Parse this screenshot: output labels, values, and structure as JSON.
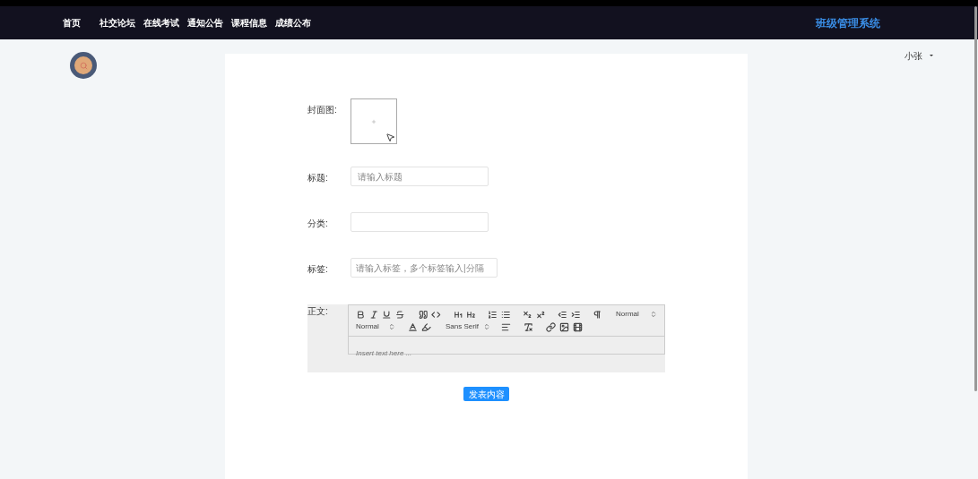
{
  "nav": {
    "items": [
      {
        "label": "首页",
        "selected": false
      },
      {
        "label": "社交论坛",
        "selected": false
      },
      {
        "label": "在线考试",
        "selected": false
      },
      {
        "label": "通知公告",
        "selected": false
      },
      {
        "label": "课程信息",
        "selected": false
      },
      {
        "label": "成绩公布",
        "selected": false
      }
    ],
    "brand": "班级管理系统"
  },
  "user": {
    "name": "小张"
  },
  "form": {
    "cover_label": "封面图:",
    "title_label": "标题:",
    "title_placeholder": "请输入标题",
    "category_label": "分类:",
    "tags_label": "标签:",
    "tags_placeholder": "请输入标签，多个标签输入|分隔",
    "body_label": "正文:",
    "editor": {
      "header_select": "Normal",
      "size_select": "Normal",
      "font_select": "Sans Serif",
      "placeholder": "Insert text here ..."
    },
    "submit": "发表内容"
  }
}
